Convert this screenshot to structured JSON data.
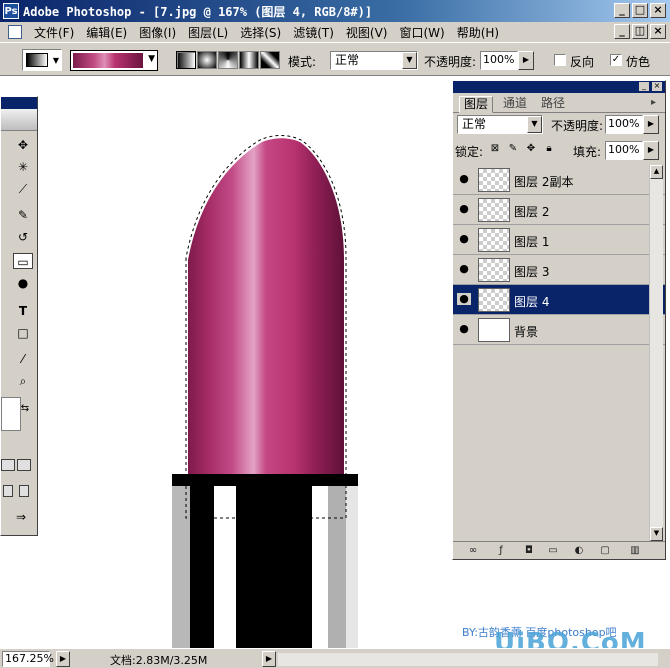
{
  "window": {
    "title": "Adobe Photoshop - [7.jpg @ 167% (图层 4, RGB/8#)]",
    "app_icon": "photoshop-icon"
  },
  "menu": [
    "文件(F)",
    "编辑(E)",
    "图像(I)",
    "图层(L)",
    "选择(S)",
    "滤镜(T)",
    "视图(V)",
    "窗口(W)",
    "帮助(H)"
  ],
  "options": {
    "mode_label": "模式:",
    "mode_value": "正常",
    "opacity_label": "不透明度:",
    "opacity_value": "100%",
    "reverse_label": "反向",
    "reverse_checked": false,
    "dither_label": "仿色",
    "dither_checked": true,
    "gradient_colors": [
      "#7d1a4c",
      "#c04b82",
      "#e090b8",
      "#b8336f",
      "#6b1440"
    ]
  },
  "layers_panel": {
    "tabs": [
      "图层",
      "通道",
      "路径"
    ],
    "blend_mode": "正常",
    "opacity_label": "不透明度:",
    "opacity_value": "100%",
    "lock_label": "锁定:",
    "fill_label": "填充:",
    "fill_value": "100%",
    "layers": [
      {
        "name": "图层 2副本",
        "visible": true,
        "selected": false
      },
      {
        "name": "图层 2",
        "visible": true,
        "selected": false
      },
      {
        "name": "图层 1",
        "visible": true,
        "selected": false
      },
      {
        "name": "图层 3",
        "visible": true,
        "selected": false
      },
      {
        "name": "图层 4",
        "visible": true,
        "selected": true
      },
      {
        "name": "背景",
        "visible": true,
        "selected": false
      }
    ],
    "selection_color": "#0a246a"
  },
  "status": {
    "zoom": "167.25%",
    "doc_info": "文档:2.83M/3.25M"
  },
  "credit": "BY:古韵香薷 百度photoshop吧",
  "watermark": "UiBQ.CoM",
  "colors": {
    "lipstick": "#b83a78",
    "case_black": "#000000",
    "case_gray": "#b8b8b8"
  }
}
